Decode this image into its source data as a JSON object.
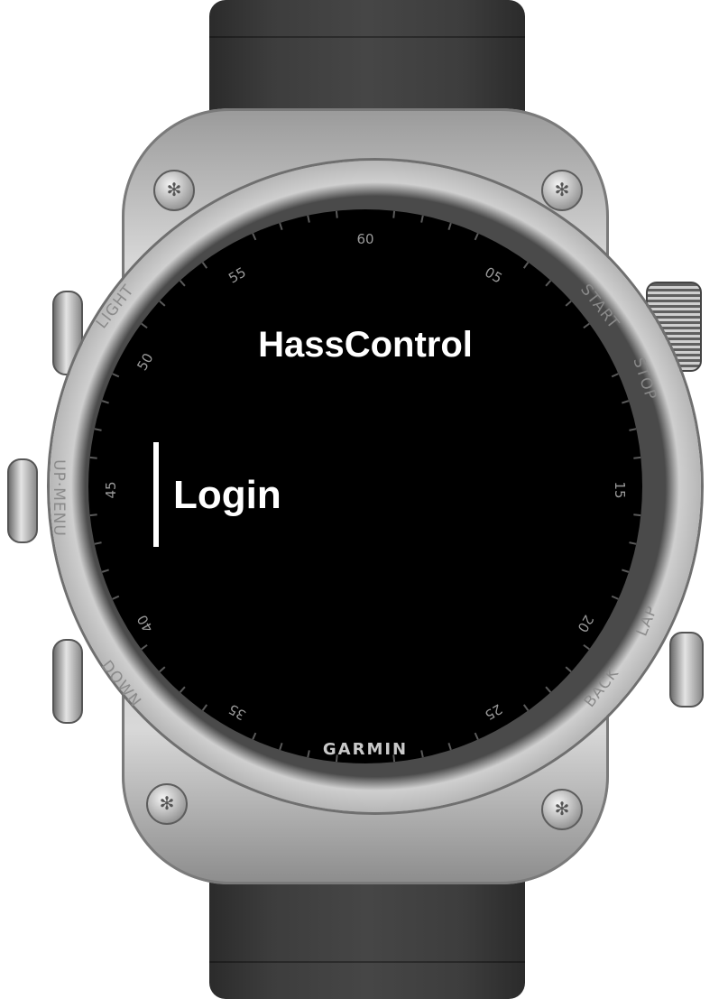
{
  "app": {
    "title": "HassControl"
  },
  "menu": {
    "items": [
      {
        "label": "Login",
        "selected": true
      }
    ]
  },
  "watch": {
    "brand": "GARMIN",
    "buttons": {
      "light": "LIGHT",
      "up_menu": "UP·MENU",
      "down": "DOWN",
      "start": "START",
      "stop": "STOP",
      "lap": "LAP",
      "back": "BACK"
    },
    "dial_numbers": [
      "60",
      "05",
      "15",
      "20",
      "25",
      "35",
      "40",
      "45",
      "50",
      "55"
    ]
  },
  "colors": {
    "screen_bg": "#000000",
    "text": "#ffffff",
    "bezel": "#c8c8c8",
    "strap": "#3c3c3c"
  }
}
